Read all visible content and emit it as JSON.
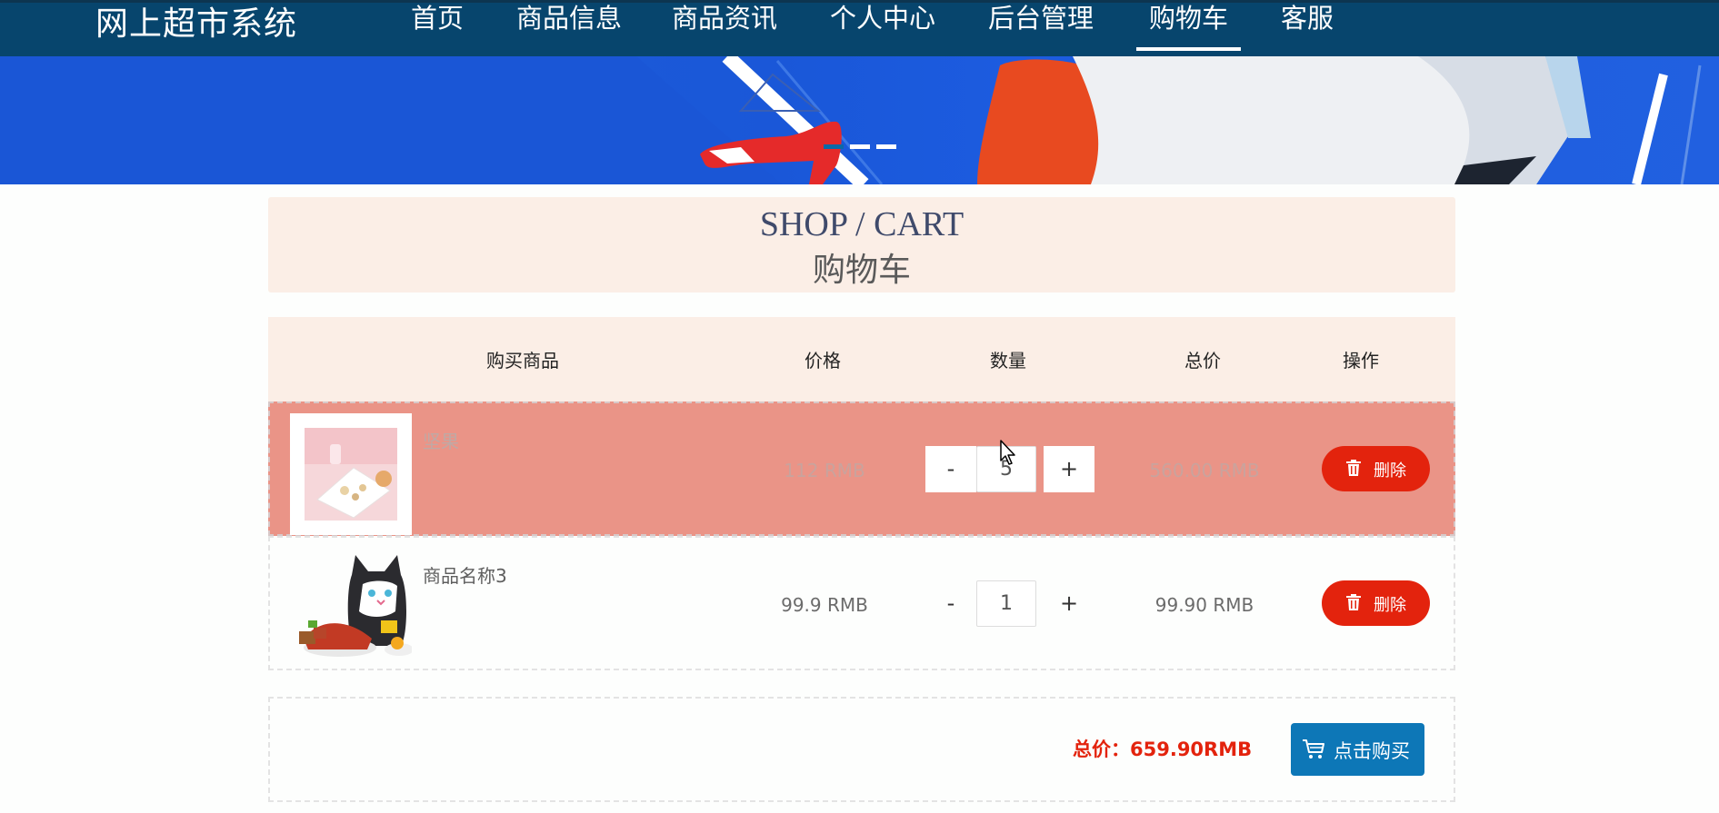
{
  "nav": {
    "brand": "网上超市系统",
    "items": [
      {
        "label": "首页"
      },
      {
        "label": "商品信息"
      },
      {
        "label": "商品资讯"
      },
      {
        "label": "个人中心"
      },
      {
        "label": "后台管理"
      },
      {
        "label": "购物车"
      },
      {
        "label": "客服"
      }
    ],
    "active_index": 5
  },
  "banner": {
    "slide_count": 3,
    "active_slide": 0
  },
  "title": {
    "en": "SHOP / CART",
    "zh": "购物车"
  },
  "table": {
    "headers": {
      "product": "购买商品",
      "price": "价格",
      "quantity": "数量",
      "total": "总价",
      "action": "操作"
    },
    "rows": [
      {
        "name": "坚果",
        "price": "112 RMB",
        "quantity": "5",
        "total": "560.00 RMB",
        "minus": "-",
        "plus": "+",
        "delete": "删除",
        "selected": true,
        "image_icon": "snack-dish-icon"
      },
      {
        "name": "商品名称3",
        "price": "99.9 RMB",
        "quantity": "1",
        "total": "99.90 RMB",
        "minus": "-",
        "plus": "+",
        "delete": "删除",
        "selected": false,
        "image_icon": "cat-snack-bag-icon"
      }
    ]
  },
  "summary": {
    "total_label": "总价：659.90RMB",
    "buy_label": "点击购买"
  },
  "colors": {
    "nav_bg": "#07456d",
    "header_bg": "#fbeee6",
    "selected_row": "#ea9487",
    "danger": "#e3230d",
    "primary": "#0d77b7"
  }
}
